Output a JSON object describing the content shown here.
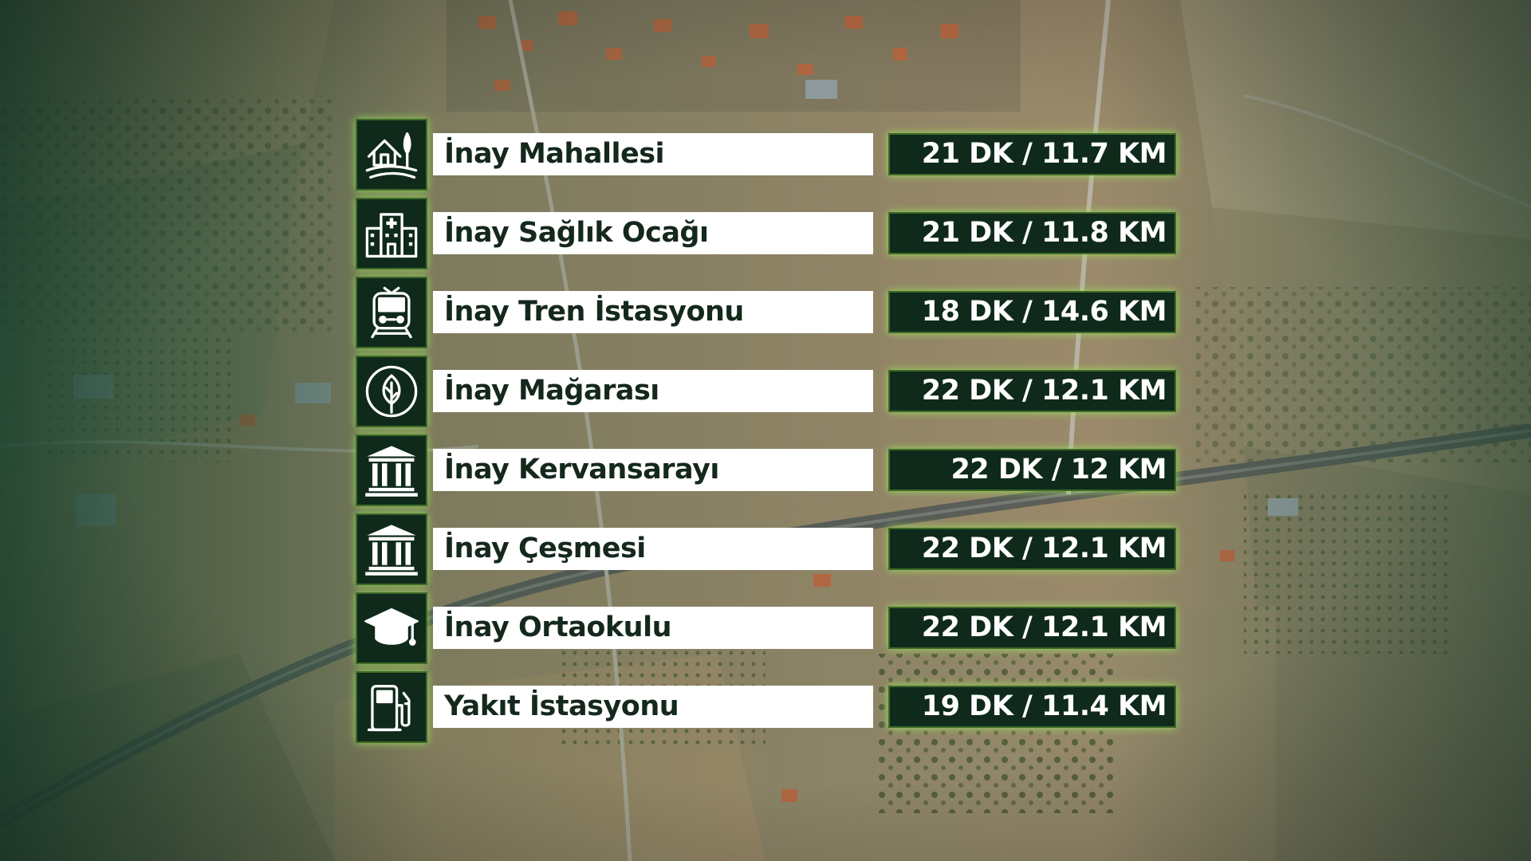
{
  "colors": {
    "panel_dark": "#0f2a1b",
    "glow": "#a0e65a",
    "label_bg": "#ffffff",
    "label_text": "#14281c",
    "value_text": "#ffffff"
  },
  "locations": [
    {
      "name": "İnay Mahallesi",
      "distance": "21 DK / 11.7 KM",
      "icon": "house-landscape-icon"
    },
    {
      "name": "İnay Sağlık Ocağı",
      "distance": "21 DK / 11.8 KM",
      "icon": "hospital-icon"
    },
    {
      "name": "İnay Tren İstasyonu",
      "distance": "18 DK / 14.6 KM",
      "icon": "train-icon"
    },
    {
      "name": "İnay Mağarası",
      "distance": "22 DK / 12.1 KM",
      "icon": "leaf-circle-icon"
    },
    {
      "name": "İnay Kervansarayı",
      "distance": "22 DK / 12 KM",
      "icon": "historic-building-icon"
    },
    {
      "name": "İnay Çeşmesi",
      "distance": "22 DK / 12.1 KM",
      "icon": "historic-building-icon"
    },
    {
      "name": "İnay Ortaokulu",
      "distance": "22 DK / 12.1 KM",
      "icon": "graduation-cap-icon"
    },
    {
      "name": "Yakıt İstasyonu",
      "distance": "19 DK / 11.4 KM",
      "icon": "fuel-pump-icon"
    }
  ]
}
